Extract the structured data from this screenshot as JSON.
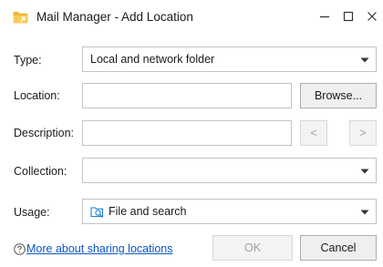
{
  "window": {
    "title": "Mail Manager - Add Location",
    "app_icon": "folder-icon",
    "controls": [
      "minimize-icon",
      "maximize-icon",
      "close-icon"
    ]
  },
  "form": {
    "type": {
      "label": "Type:",
      "value": "Local and network folder"
    },
    "location": {
      "label": "Location:",
      "value": "",
      "browse_label": "Browse..."
    },
    "description": {
      "label": "Description:",
      "value": "",
      "prev_label": "<",
      "next_label": ">"
    },
    "collection": {
      "label": "Collection:",
      "value": ""
    },
    "usage": {
      "label": "Usage:",
      "value": "File and search",
      "icon": "folder-search-icon"
    }
  },
  "footer": {
    "help_link": "More about sharing locations",
    "help_icon": "question-circle-icon",
    "ok_label": "OK",
    "cancel_label": "Cancel"
  },
  "colors": {
    "link": "#0a56c2",
    "app_icon": "#f2b630",
    "usage_icon": "#1e7fd6",
    "disabled_text": "#a0a0a0"
  }
}
